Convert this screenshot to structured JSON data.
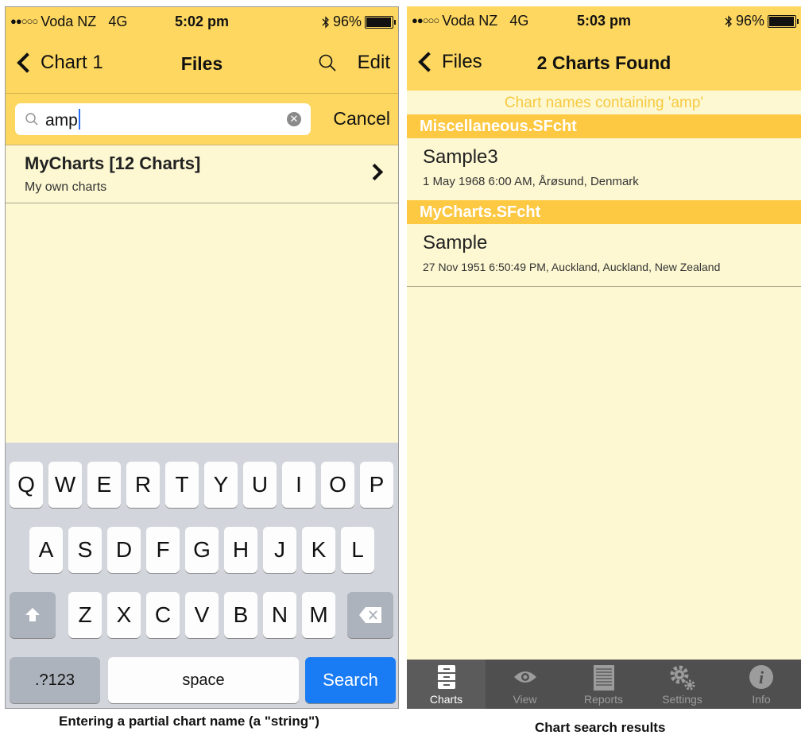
{
  "left_screen": {
    "status": {
      "carrier": "Voda NZ",
      "network": "4G",
      "time": "5:02 pm",
      "battery": "96%",
      "battery_level": 0.96
    },
    "nav": {
      "back_label": "Chart 1",
      "title": "Files",
      "edit_label": "Edit"
    },
    "search": {
      "value": "amp",
      "cancel_label": "Cancel"
    },
    "list": [
      {
        "title": "MyCharts [12 Charts]",
        "subtitle": "My own charts"
      }
    ],
    "keyboard": {
      "row1": [
        "Q",
        "W",
        "E",
        "R",
        "T",
        "Y",
        "U",
        "I",
        "O",
        "P"
      ],
      "row2": [
        "A",
        "S",
        "D",
        "F",
        "G",
        "H",
        "J",
        "K",
        "L"
      ],
      "row3": [
        "Z",
        "X",
        "C",
        "V",
        "B",
        "N",
        "M"
      ],
      "numbers_label": ".?123",
      "space_label": "space",
      "search_label": "Search"
    }
  },
  "right_screen": {
    "status": {
      "carrier": "Voda NZ",
      "network": "4G",
      "time": "5:03 pm",
      "battery": "96%",
      "battery_level": 0.96
    },
    "nav": {
      "back_label": "Files",
      "title": "2 Charts Found"
    },
    "banner": "Chart names containing 'amp'",
    "sections": [
      {
        "header": "Miscellaneous.SFcht",
        "chart": {
          "name": "Sample3",
          "details": "1 May 1968 6:00 AM, Årøsund, Denmark"
        }
      },
      {
        "header": "MyCharts.SFcht",
        "chart": {
          "name": "Sample",
          "details": "27 Nov 1951 6:50:49 PM, Auckland, Auckland, New Zealand"
        }
      }
    ],
    "tabs": [
      "Charts",
      "View",
      "Reports",
      "Settings",
      "Info"
    ]
  },
  "captions": {
    "left": "Entering a partial chart name (a \"string\")",
    "right": "Chart search results"
  },
  "colors": {
    "bar": "#fdd760",
    "section": "#fdc842",
    "background": "#fdf8d2",
    "search_key": "#1a7cf5"
  }
}
